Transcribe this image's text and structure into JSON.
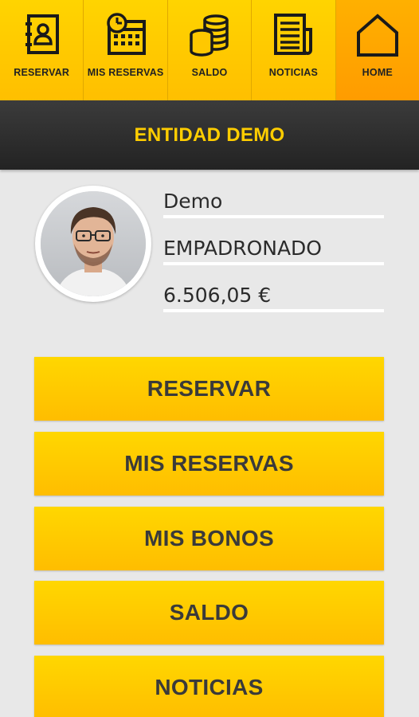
{
  "nav": {
    "items": [
      {
        "label": "RESERVAR",
        "icon": "address-book-icon"
      },
      {
        "label": "MIS RESERVAS",
        "icon": "calendar-clock-icon"
      },
      {
        "label": "SALDO",
        "icon": "coin-stack-icon"
      },
      {
        "label": "NOTICIAS",
        "icon": "newspaper-icon"
      },
      {
        "label": "HOME",
        "icon": "home-icon",
        "active": true
      }
    ]
  },
  "header": {
    "title": "ENTIDAD DEMO"
  },
  "profile": {
    "name": "Demo",
    "status": "EMPADRONADO",
    "balance": "6.506,05 €"
  },
  "menu": {
    "reservar": "RESERVAR",
    "mis_reservas": "MIS RESERVAS",
    "mis_bonos": "MIS BONOS",
    "saldo": "SALDO",
    "noticias": "NOTICIAS"
  },
  "colors": {
    "accent": "#ffc600",
    "active_tab": "#ffa800",
    "header_bg": "#2c2c2c",
    "header_text": "#ffcd00"
  }
}
